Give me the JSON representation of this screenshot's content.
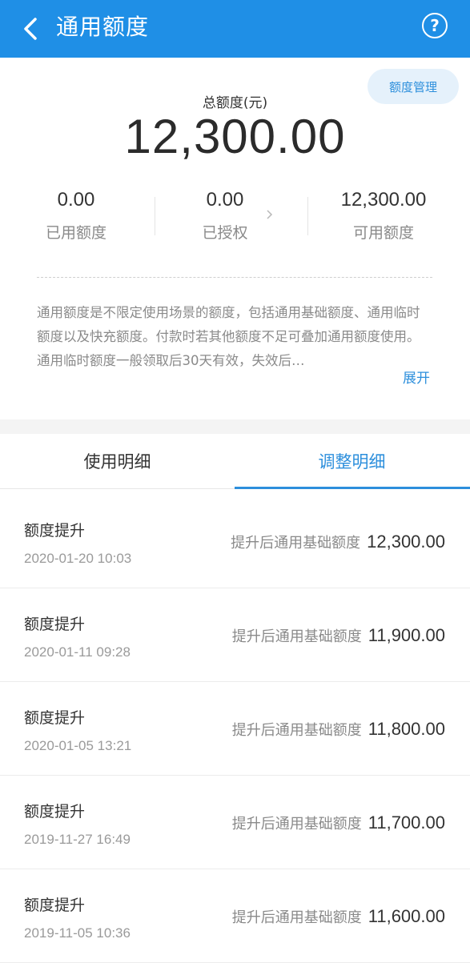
{
  "header": {
    "title": "通用额度",
    "back_icon": "chevron-left-icon",
    "help_label": "?"
  },
  "summary": {
    "manage_label": "额度管理",
    "total_label": "总额度(元)",
    "total_amount": "12,300.00",
    "stats": [
      {
        "value": "0.00",
        "label": "已用额度"
      },
      {
        "value": "0.00",
        "label": "已授权"
      },
      {
        "value": "12,300.00",
        "label": "可用额度"
      }
    ],
    "description": "通用额度是不限定使用场景的额度，包括通用基础额度、通用临时额度以及快充额度。付款时若其他额度不足可叠加通用额度使用。通用临时额度一般领取后30天有效，失效后…",
    "expand_label": "展开"
  },
  "tabs": [
    {
      "label": "使用明细",
      "active": false
    },
    {
      "label": "调整明细",
      "active": true
    }
  ],
  "records": [
    {
      "title": "额度提升",
      "date": "2020-01-20 10:03",
      "desc": "提升后通用基础额度",
      "amount": "12,300.00"
    },
    {
      "title": "额度提升",
      "date": "2020-01-11 09:28",
      "desc": "提升后通用基础额度",
      "amount": "11,900.00"
    },
    {
      "title": "额度提升",
      "date": "2020-01-05 13:21",
      "desc": "提升后通用基础额度",
      "amount": "11,800.00"
    },
    {
      "title": "额度提升",
      "date": "2019-11-27 16:49",
      "desc": "提升后通用基础额度",
      "amount": "11,700.00"
    },
    {
      "title": "额度提升",
      "date": "2019-11-05 10:36",
      "desc": "提升后通用基础额度",
      "amount": "11,600.00"
    }
  ],
  "colors": {
    "header_bg": "#1f8fe6",
    "accent": "#2d8fdc"
  }
}
